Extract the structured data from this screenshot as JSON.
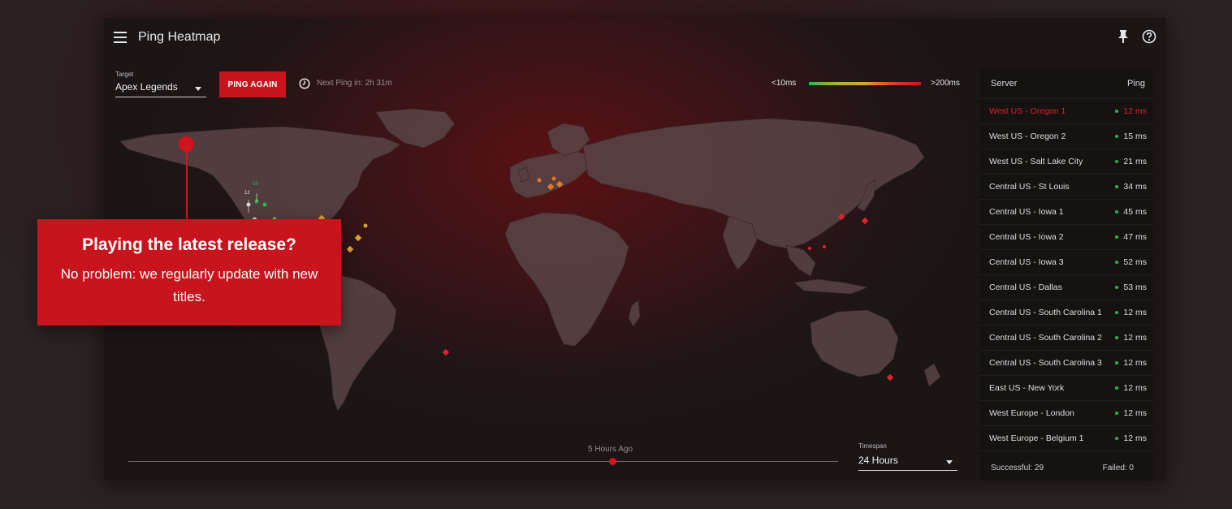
{
  "app": {
    "title": "Ping Heatmap",
    "menu_icon": "hamburger-menu-icon",
    "pin_icon": "pin-icon",
    "help_icon": "help-circle-icon"
  },
  "controls": {
    "target_label": "Target",
    "target_value": "Apex Legends",
    "ping_button": "PING AGAIN",
    "clock_icon": "clock-icon",
    "next_ping": "Next Ping in: 2h 31m"
  },
  "legend": {
    "min_label": "<10ms",
    "max_label": ">200ms",
    "colors": [
      "#36b14a",
      "#a3b534",
      "#e0a030",
      "#d8421f",
      "#c8141c"
    ]
  },
  "map": {
    "pin_labels": [
      "15",
      "12"
    ]
  },
  "timeline": {
    "label": "5 Hours Ago",
    "timespan_label": "Timespan",
    "timespan_value": "24 Hours"
  },
  "servers": {
    "header_server": "Server",
    "header_ping": "Ping",
    "rows": [
      {
        "name": "West US - Oregon 1",
        "ping": "12 ms"
      },
      {
        "name": "West US - Oregon 2",
        "ping": "15 ms"
      },
      {
        "name": "West US - Salt Lake City",
        "ping": "21 ms"
      },
      {
        "name": "Central US - St Louis",
        "ping": "34 ms"
      },
      {
        "name": "Central US - Iowa 1",
        "ping": "45 ms"
      },
      {
        "name": "Central US - Iowa 2",
        "ping": "47 ms"
      },
      {
        "name": "Central US - Iowa 3",
        "ping": "52 ms"
      },
      {
        "name": "Central US - Dallas",
        "ping": "53 ms"
      },
      {
        "name": "Central US - South Carolina 1",
        "ping": "12 ms"
      },
      {
        "name": "Central US - South Carolina 2",
        "ping": "12 ms"
      },
      {
        "name": "Central US - South Carolina 3",
        "ping": "12 ms"
      },
      {
        "name": "East US - New York",
        "ping": "12 ms"
      },
      {
        "name": "West Europe - London",
        "ping": "12 ms"
      },
      {
        "name": "West Europe - Belgium 1",
        "ping": "12 ms"
      }
    ],
    "successful": "Successful: 29",
    "failed": "Failed: 0"
  },
  "callout": {
    "title": "Playing the latest release?",
    "body": "No problem: we regularly update with new titles."
  },
  "colors": {
    "accent": "#c8141c",
    "status_good": "#2db34a"
  }
}
